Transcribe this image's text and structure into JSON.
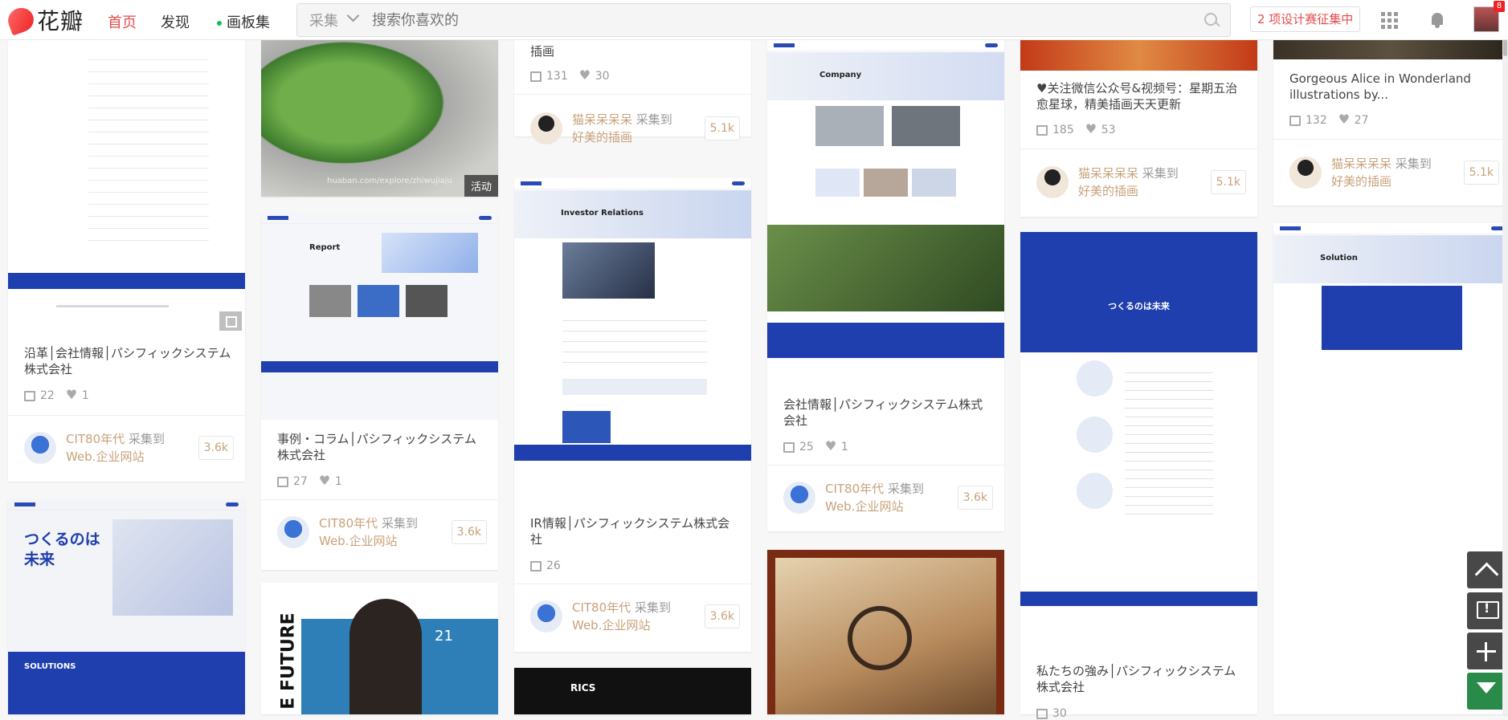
{
  "header": {
    "logo_text": "花瓣",
    "nav": {
      "home": "首页",
      "discover": "发现",
      "boards": "画板集"
    },
    "search": {
      "category": "采集",
      "placeholder": "搜索你喜欢的"
    },
    "contest_label": "2 项设计赛征集中",
    "notification_badge": "8"
  },
  "cards": {
    "c1": {
      "title": "沿革│会社情報│パシフィックシステム株式会社",
      "repins": "22",
      "likes": "1",
      "user": "CIT80年代",
      "action": "采集到",
      "board": "Web.企业网站",
      "count": "3.6k"
    },
    "c2": {
      "img_text_1": "つくるのは",
      "img_text_2": "未来",
      "img_text_3": "SOLUTIONS"
    },
    "c3": {
      "watermark": "huaban.com/explore/zhiwujiaju",
      "tag": "活动"
    },
    "c4": {
      "img_text": "Report",
      "title": "事例・コラム│パシフィックシステム株式会社",
      "repins": "27",
      "likes": "1",
      "user": "CIT80年代",
      "action": "采集到",
      "board": "Web.企业网站",
      "count": "3.6k"
    },
    "c5": {
      "img_text_1": "E FUTURE",
      "img_text_2": "21"
    },
    "c6": {
      "title": "插画",
      "repins": "131",
      "likes": "30",
      "user": "猫呆呆呆呆",
      "action": "采集到",
      "board": "好美的插画",
      "count": "5.1k"
    },
    "c7": {
      "img_text": "Investor Relations",
      "title": "IR情報│パシフィックシステム株式会社",
      "repins": "26",
      "user": "CIT80年代",
      "action": "采集到",
      "board": "Web.企业网站",
      "count": "3.6k"
    },
    "c8": {
      "img_text": "RICS"
    },
    "c9": {
      "img_text": "Company",
      "title": "会社情報│パシフィックシステム株式会社",
      "repins": "25",
      "likes": "1",
      "user": "CIT80年代",
      "action": "采集到",
      "board": "Web.企业网站",
      "count": "3.6k"
    },
    "c11": {
      "title": "♥关注微信公众号&视频号：星期五治愈星球，精美插画天天更新",
      "repins": "185",
      "likes": "53",
      "user": "猫呆呆呆呆",
      "action": "采集到",
      "board": "好美的插画",
      "count": "5.1k"
    },
    "c12": {
      "img_text": "つくるのは未来",
      "title": "私たちの強み│パシフィックシステム株式会社",
      "repins": "30"
    },
    "c13": {
      "title": "Gorgeous Alice in Wonderland illustrations by...",
      "repins": "132",
      "likes": "27",
      "user": "猫呆呆呆呆",
      "action": "采集到",
      "board": "好美的插画",
      "count": "5.1k"
    },
    "c14": {
      "img_text": "Solution"
    }
  },
  "colors": {
    "accent": "#e54c4c",
    "brand_blue": "#1f3fae",
    "user_link": "#c8a27a"
  }
}
